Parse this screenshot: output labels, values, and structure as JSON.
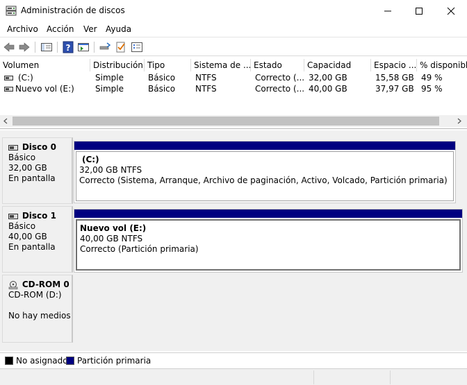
{
  "window": {
    "title": "Administración de discos"
  },
  "menu": [
    "Archivo",
    "Acción",
    "Ver",
    "Ayuda"
  ],
  "toolbar_icons": [
    "back-arrow-icon",
    "forward-arrow-icon",
    "console-tree-icon",
    "help-icon",
    "properties-icon",
    "rescan-icon",
    "checklist-icon",
    "settings-list-icon"
  ],
  "columns": [
    "Volumen",
    "Distribución",
    "Tipo",
    "Sistema de ...",
    "Estado",
    "Capacidad",
    "Espacio ...",
    "% disponibl"
  ],
  "volumes": [
    {
      "name": "(C:)",
      "layout": "Simple",
      "type": "Básico",
      "fs": "NTFS",
      "status": "Correcto (...",
      "capacity": "32,00 GB",
      "free": "15,58 GB",
      "pct": "49 %"
    },
    {
      "name": "Nuevo vol (E:)",
      "layout": "Simple",
      "type": "Básico",
      "fs": "NTFS",
      "status": "Correcto (...",
      "capacity": "40,00 GB",
      "free": "37,97 GB",
      "pct": "95 %"
    }
  ],
  "disks": [
    {
      "name": "Disco 0",
      "kind": "Básico",
      "size": "32,00 GB",
      "state": "En pantalla",
      "partition": {
        "name": "(C:)",
        "size_fs": "32,00 GB NTFS",
        "status": "Correcto (Sistema, Arranque, Archivo de paginación, Activo, Volcado, Partición primaria)"
      }
    },
    {
      "name": "Disco 1",
      "kind": "Básico",
      "size": "40,00 GB",
      "state": "En pantalla",
      "partition": {
        "name": "Nuevo vol  (E:)",
        "size_fs": "40,00 GB NTFS",
        "status": "Correcto (Partición primaria)"
      }
    },
    {
      "name": "CD-ROM 0",
      "kind": "CD-ROM (D:)",
      "size": "",
      "state": "No hay medios"
    }
  ],
  "legend": [
    {
      "label": "No asignado",
      "color": "#000000"
    },
    {
      "label": "Partición primaria",
      "color": "#000080"
    }
  ]
}
